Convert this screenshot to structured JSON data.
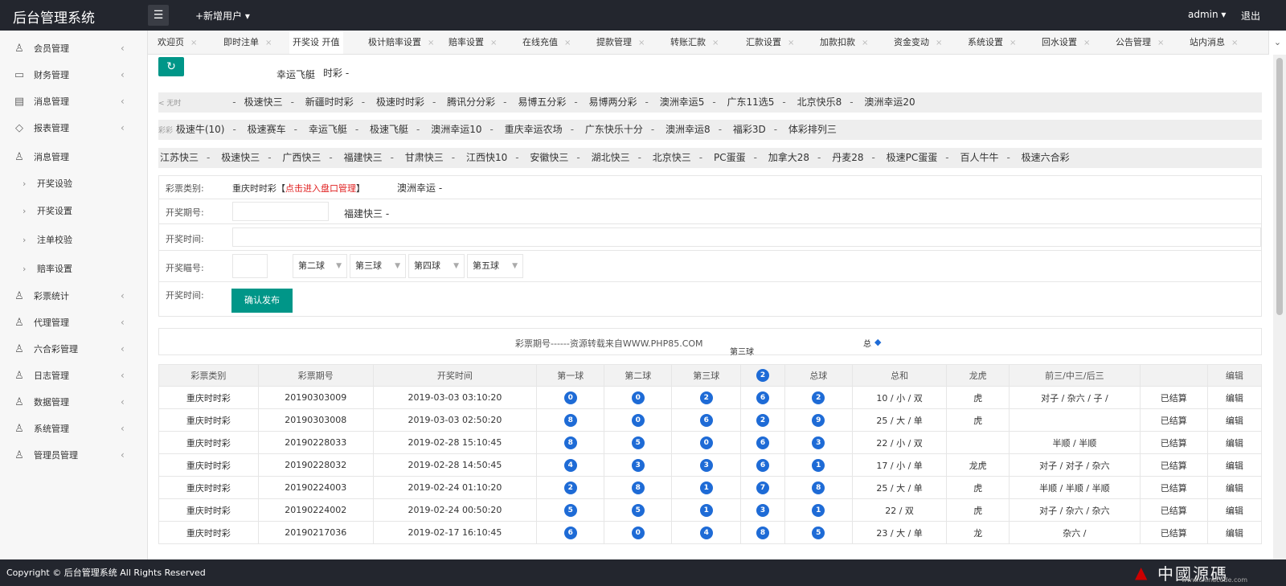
{
  "app": {
    "title": "后台管理系统",
    "add_user": "+新增用户 ▾",
    "user": "admin ▾",
    "logout": "退出"
  },
  "sidebar": {
    "items": [
      {
        "label": "会员管理",
        "icon": "user-icon"
      },
      {
        "label": "财务管理",
        "icon": "book-icon"
      },
      {
        "label": "消息管理",
        "icon": "doc-icon"
      },
      {
        "label": "报表管理",
        "icon": "chart-icon"
      },
      {
        "label": "消息管理",
        "icon": "user-icon"
      }
    ],
    "subitems": [
      "开奖设验",
      "开奖设置",
      "注单校验",
      "赔率设置"
    ],
    "items2": [
      {
        "label": "彩票统计"
      },
      {
        "label": "代理管理"
      },
      {
        "label": "六合彩管理"
      },
      {
        "label": "日志管理"
      },
      {
        "label": "数据管理"
      },
      {
        "label": "系统管理"
      },
      {
        "label": "管理员管理"
      }
    ]
  },
  "tabs": [
    "欢迎页",
    "即时注单",
    "开奖设  开值",
    "极计赔率设置",
    "赔率设置",
    "在线充值",
    "提款管理",
    "转账汇款",
    "汇款设置",
    "加款扣款",
    "资金变动",
    "系统设置",
    "回水设置",
    "公告管理",
    "站内消息"
  ],
  "floating": {
    "a": "幸运飞艇",
    "b": "时彩  -",
    "c": "澳洲幸运  -",
    "d": "福建快三  -",
    "e": "< 无时",
    "f": "第三球",
    "g": "总",
    "h": "彩彩"
  },
  "lottery_rows": [
    [
      "极速快三",
      "新疆时时彩",
      "极速时时彩",
      "腾讯分分彩",
      "易博五分彩",
      "易博两分彩",
      "澳洲幸运5",
      "广东11选5",
      "北京快乐8",
      "澳洲幸运20"
    ],
    [
      "极速牛(10)",
      "极速赛车",
      "幸运飞艇",
      "极速飞艇",
      "澳洲幸运10",
      "重庆幸运农场",
      "广东快乐十分",
      "澳洲幸运8",
      "福彩3D",
      "体彩排列三"
    ],
    [
      "江苏快三",
      "极速快三",
      "广西快三",
      "福建快三",
      "甘肃快三",
      "江西快10",
      "安徽快三",
      "湖北快三",
      "北京快三",
      "PC蛋蛋",
      "加拿大28",
      "丹麦28",
      "极速PC蛋蛋",
      "百人牛牛",
      "极速六合彩"
    ]
  ],
  "form": {
    "type_label": "彩票类别:",
    "type_value": "重庆时时彩【",
    "type_link": "点击进入盘口管理",
    "type_close": "】",
    "period_label": "开奖期号:",
    "time_label": "开奖时间:",
    "numbers_label": "开奖瞄号:",
    "time2_label": "开奖时间:",
    "selects": [
      "第二球",
      "第三球",
      "第四球",
      "第五球"
    ],
    "publish": "确认发布"
  },
  "search": {
    "text": "彩票期号------资源转载来自WWW.PHP85.COM"
  },
  "table": {
    "headers": [
      "彩票类别",
      "彩票期号",
      "开奖时间",
      "第一球",
      "第二球",
      "第三球",
      "2",
      "总球",
      "总和",
      "龙虎",
      "前三/中三/后三",
      "",
      "编辑"
    ],
    "rows": [
      {
        "type": "重庆时时彩",
        "period": "20190303009",
        "time": "2019-03-03 03:10:20",
        "balls": [
          "0",
          "0",
          "2",
          "6",
          "2"
        ],
        "sum": "10 / 小 / 双",
        "lh": "虎",
        "pos": "对子 / 杂六 / 子 /",
        "status": "已结算",
        "edit": "编辑"
      },
      {
        "type": "重庆时时彩",
        "period": "20190303008",
        "time": "2019-03-03 02:50:20",
        "balls": [
          "8",
          "0",
          "6",
          "2",
          "9"
        ],
        "sum": "25 / 大 / 单",
        "lh": "虎",
        "pos": "",
        "status": "已结算",
        "edit": "编辑"
      },
      {
        "type": "重庆时时彩",
        "period": "20190228033",
        "time": "2019-02-28 15:10:45",
        "balls": [
          "8",
          "5",
          "0",
          "6",
          "3"
        ],
        "sum": "22 / 小 / 双",
        "lh": "",
        "pos": "半顺 / 半顺",
        "status": "已结算",
        "edit": "编辑"
      },
      {
        "type": "重庆时时彩",
        "period": "20190228032",
        "time": "2019-02-28 14:50:45",
        "balls": [
          "4",
          "3",
          "3",
          "6",
          "1"
        ],
        "sum": "17 / 小 / 单",
        "lh": "龙虎",
        "pos": "对子 / 对子 / 杂六",
        "status": "已结算",
        "edit": "编辑"
      },
      {
        "type": "重庆时时彩",
        "period": "20190224003",
        "time": "2019-02-24 01:10:20",
        "balls": [
          "2",
          "8",
          "1",
          "7",
          "8"
        ],
        "sum": "25 / 大 / 单",
        "lh": "虎",
        "pos": "半顺 / 半顺 / 半顺",
        "status": "已结算",
        "edit": "编辑"
      },
      {
        "type": "重庆时时彩",
        "period": "20190224002",
        "time": "2019-02-24 00:50:20",
        "balls": [
          "5",
          "5",
          "1",
          "3",
          "1"
        ],
        "sum": "22 /   双",
        "lh": "虎",
        "pos": "对子 / 杂六 / 杂六",
        "status": "已结算",
        "edit": "编辑"
      },
      {
        "type": "重庆时时彩",
        "period": "20190217036",
        "time": "2019-02-17 16:10:45",
        "balls": [
          "6",
          "0",
          "4",
          "8",
          "5"
        ],
        "sum": "23 / 大 / 单",
        "lh": "龙",
        "pos": "杂六 /",
        "status": "已结算",
        "edit": "编辑"
      }
    ]
  },
  "footer": {
    "copyright": "Copyright © 后台管理系统 All Rights Reserved"
  },
  "watermark": {
    "text": "中國源碼",
    "url": "www.chinacode.com"
  },
  "colors": {
    "topbar": "#23262e",
    "accent": "#009688",
    "ball": "#1e6bd6",
    "status": "#e02020"
  }
}
